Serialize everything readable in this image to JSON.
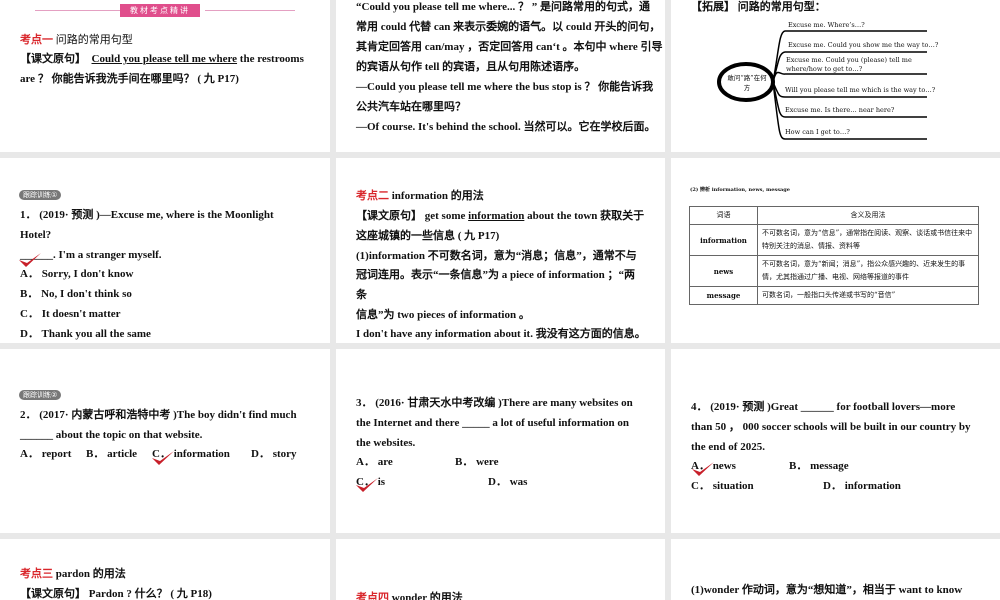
{
  "s1": {
    "banner": "教材考点精讲",
    "point_tag": "考点一",
    "point_title": "问路的常用句型",
    "orig_tag": "【课文原句】",
    "orig_en": "Could you please tell me where",
    "orig_rest": " the restrooms",
    "line2": "are ？ 你能告诉我洗手间在哪里吗？ ( 九 P17)"
  },
  "s2": {
    "lines": [
      "“Could you please tell me where... ？ ” 是问路常用的句式，通",
      "常用 could 代替 can 来表示委婉的语气。以 could 开头的问句，",
      "其肯定回答用 can/may ，否定回答用 can‘t 。本句中 where 引导",
      "的宾语从句作 tell 的宾语，且从句用陈述语序。",
      "—Could you please tell me where the bus stop is ？ 你能告诉我",
      "公共汽车站在哪里吗？",
      "—Of course. It's behind the school. 当然可以。它在学校后面。"
    ]
  },
  "s3": {
    "title": "【拓展】 问路的常用句型：",
    "center": "敢问“路”在何方",
    "branches": [
      "Excuse me. Where’s…?",
      "Excuse me. Could you show me the way to…?",
      "Excuse me. Could you (please) tell me",
      "where/how to get to…?",
      "Will you please tell me which is the way to…?",
      "Excuse me. Is there… near here?",
      "How can I get to…?"
    ]
  },
  "s4": {
    "badge": "跟踪训练①",
    "q": "1．  (2019· 预测 )—Excuse me, where is the Moonlight",
    "q2": "Hotel?",
    "q3": "______. I'm a stranger myself.",
    "options": [
      "A．  Sorry, I don't know",
      "B．  No, I don't think so",
      "C．  It doesn't matter",
      "D．  Thank you all the same"
    ]
  },
  "s5": {
    "point_tag": "考点二",
    "point_title": " information 的用法",
    "orig_tag": "【课文原句】",
    "orig_a": "  get some ",
    "orig_u": "information",
    "orig_b": " about the town 获取关于",
    "lines": [
      "这座城镇的一些信息 ( 九 P17)",
      "(1)information 不可数名词，意为“消息；信息”，通常不与",
      "冠词连用。表示“一条信息”为 a piece of information ；“两",
      "条",
      "信息”为 two pieces of information 。",
      "I don't have any information about it. 我没有这方面的信息。"
    ]
  },
  "s6": {
    "caption": "(2) 辨析 information, news, message",
    "headers": [
      "词语",
      "含义及用法"
    ],
    "rows": [
      {
        "word": "information",
        "desc": "不可数名词，意为“信息”，通常指在阅读、观察、谈话或书信往来中特别关注的消息、情报、资料等"
      },
      {
        "word": "news",
        "desc": "不可数名词，意为“新闻；消息”，指公众感兴趣的、近来发生的事情，尤其指通过广播、电视、网络等报道的事件"
      },
      {
        "word": "message",
        "desc": "可数名词，一般指口头传递或书写的“音信”"
      }
    ]
  },
  "s7": {
    "badge": "跟踪训练②",
    "q": "2．  (2017· 内蒙古呼和浩特中考 )The boy didn't find much",
    "q2": "______ about the topic on that website.",
    "options": [
      "A．  report",
      "B．  article",
      "C．  information",
      "D．  story"
    ]
  },
  "s8": {
    "q": "3．  (2016· 甘肃天水中考改编 )There are many websites on",
    "q2": "the Internet and there _____ a lot of useful information on",
    "q3": "the websites.",
    "options": [
      "A．  are",
      "B．  were",
      "C．  is",
      "D．  was"
    ]
  },
  "s9": {
    "q": "4．  (2019· 预测 )Great ______ for football lovers—more",
    "q2": "than 50 ，  000 soccer schools will be built in our country by",
    "q3": "the end of 2025.",
    "options": [
      "A．  news",
      "B．  message",
      "C．  situation",
      "D．  information"
    ]
  },
  "s10": {
    "point_tag": "考点三",
    "point_title": " pardon 的用法",
    "orig_tag": "【课文原句】",
    "orig_rest": "  Pardon ? 什么？ ( 九 P18)"
  },
  "s11": {
    "point_tag": "考点四",
    "point_title": " wonder 的用法"
  },
  "s12": {
    "line": "(1)wonder 作动词，意为“想知道”，相当于 want to know"
  },
  "colors": {
    "accent": "#d9262b",
    "banner": "#e04e8c",
    "gap": "#e8e8e8"
  }
}
